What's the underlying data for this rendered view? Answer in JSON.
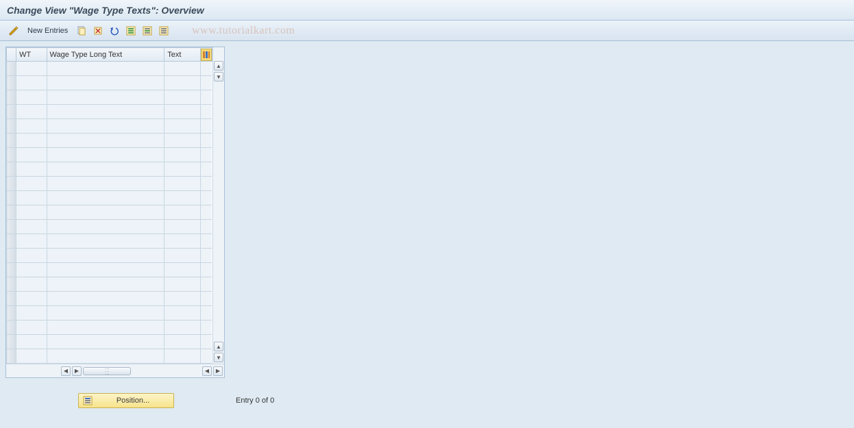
{
  "title": "Change View \"Wage Type Texts\": Overview",
  "toolbar": {
    "new_entries_label": "New Entries"
  },
  "watermark": "www.tutorialkart.com",
  "table": {
    "columns": {
      "wt": "WT",
      "long_text": "Wage Type Long Text",
      "text": "Text"
    },
    "row_count": 21
  },
  "footer": {
    "position_label": "Position...",
    "entry_status": "Entry 0 of 0"
  }
}
